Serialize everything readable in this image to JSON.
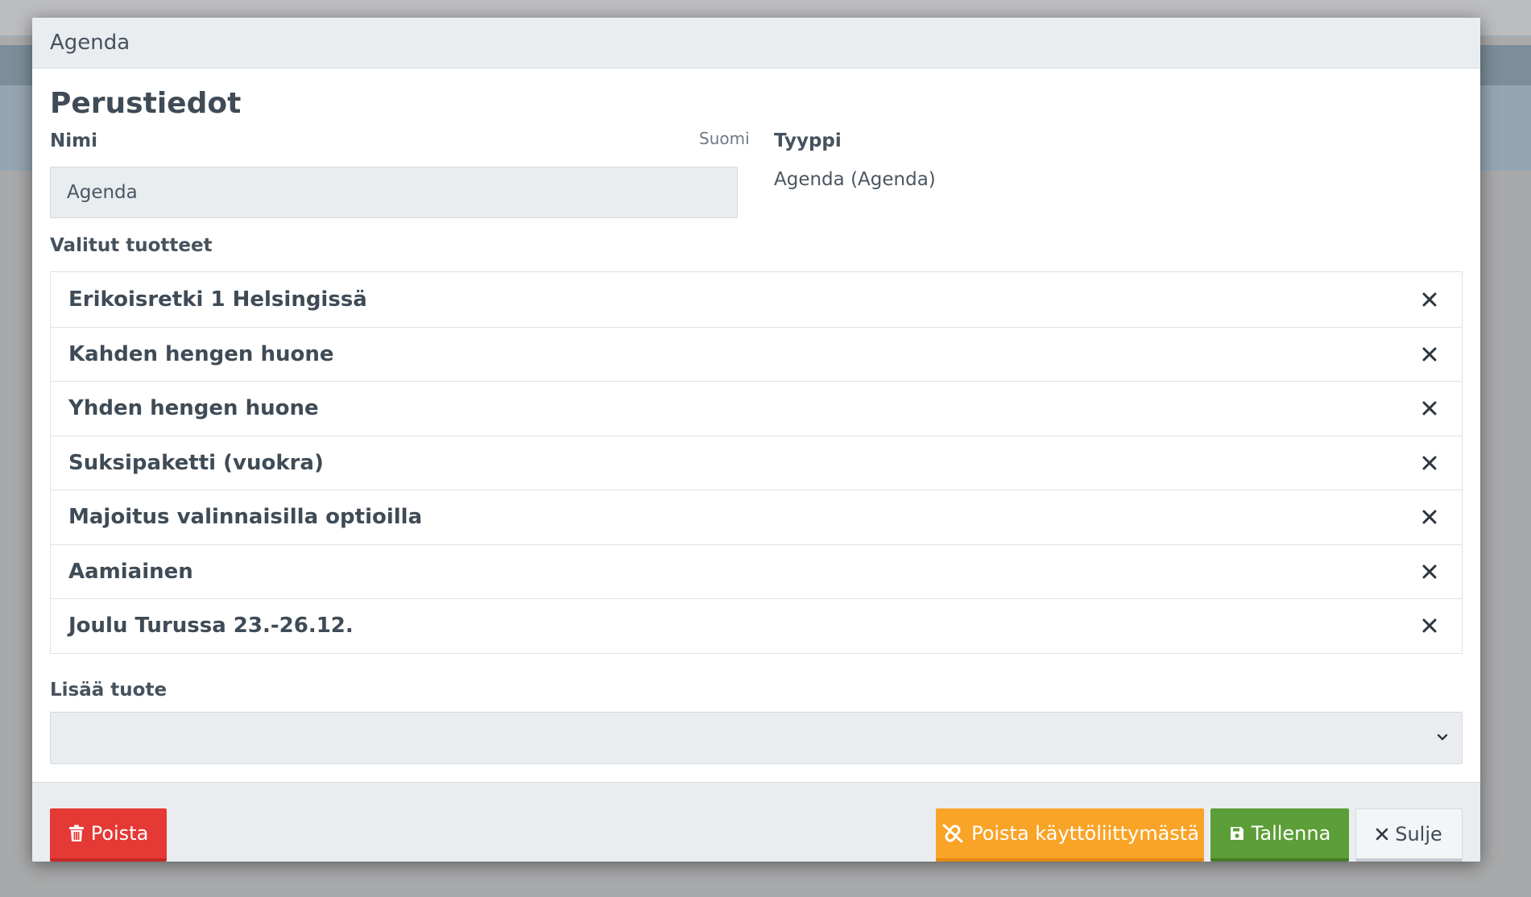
{
  "modal": {
    "title": "Agenda",
    "section_title": "Perustiedot"
  },
  "fields": {
    "name_label": "Nimi",
    "name_language": "Suomi",
    "name_value": "Agenda",
    "type_label": "Tyyppi",
    "type_value": "Agenda (Agenda)"
  },
  "selected_products": {
    "label": "Valitut tuotteet",
    "items": [
      {
        "name": "Erikoisretki 1 Helsingissä"
      },
      {
        "name": "Kahden hengen huone"
      },
      {
        "name": "Yhden hengen huone"
      },
      {
        "name": "Suksipaketti (vuokra)"
      },
      {
        "name": "Majoitus valinnaisilla optioilla"
      },
      {
        "name": "Aamiainen"
      },
      {
        "name": "Joulu Turussa 23.-26.12."
      }
    ],
    "remove_icon": "close-icon"
  },
  "add_product": {
    "label": "Lisää tuote",
    "value": ""
  },
  "footer": {
    "delete_label": "Poista",
    "unlink_label": "Poista käyttöliittymästä",
    "save_label": "Tallenna",
    "close_label": "Sulje"
  },
  "colors": {
    "delete": "#e53935",
    "unlink": "#f9a427",
    "save": "#5c9e37",
    "text": "#3f4b56"
  }
}
